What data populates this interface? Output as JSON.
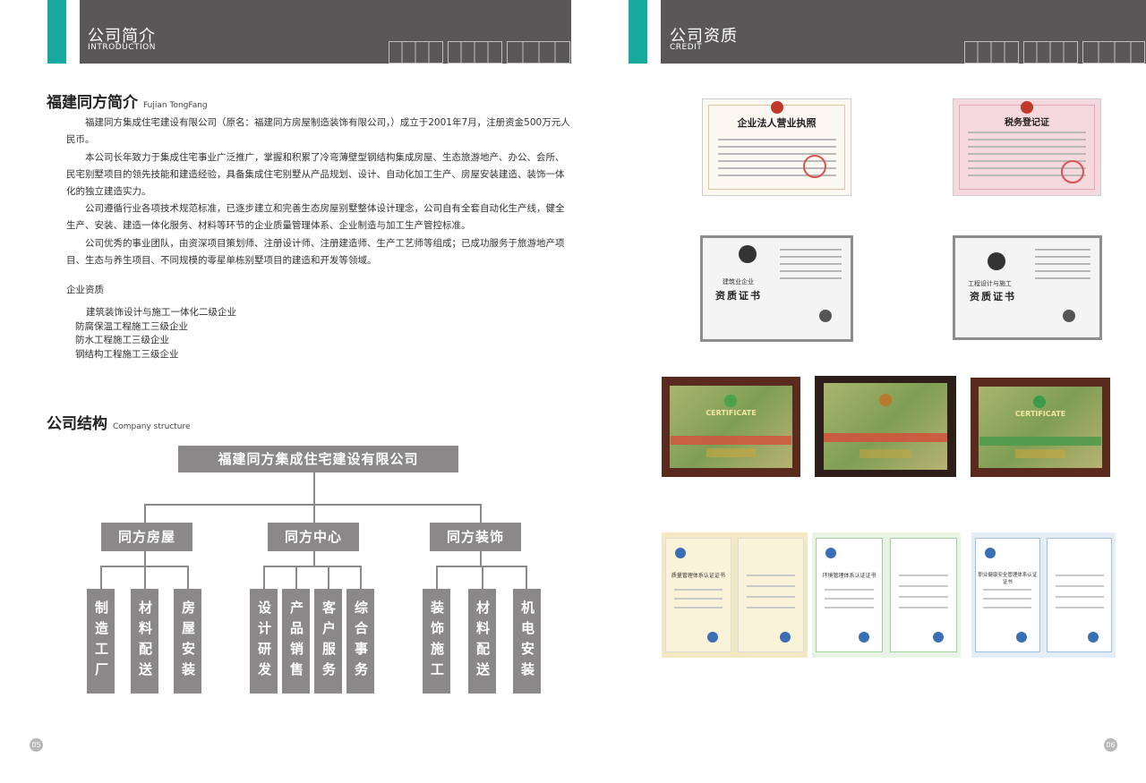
{
  "left_header": {
    "title": "公司简介",
    "subtitle": "INTRODUCTION"
  },
  "right_header": {
    "title": "公司资质",
    "subtitle": "CREDIT"
  },
  "intro": {
    "title": "福建同方简介",
    "title_en": "Fujian TongFang",
    "paragraphs": [
      "福建同方集成住宅建设有限公司（原名：福建同方房屋制造装饰有限公司，）成立于2001年7月，注册资金500万元人民币。",
      "本公司长年致力于集成住宅事业广泛推广，掌握和积累了冷弯薄壁型钢结构集成房屋、生态旅游地产、办公、会所、民宅别墅项目的领先技能和建造经验，具备集成住宅别墅从产品规划、设计、自动化加工生产、房屋安装建造、装饰一体化的独立建造实力。",
      "公司遵循行业各项技术规范标准，已逐步建立和完善生态房屋别墅整体设计理念，公司自有全套自动化生产线，健全生产、安装、建造一体化服务、材料等环节的企业质量管理体系、企业制造与加工生产管控标准。",
      "公司优秀的事业团队，由资深项目策划师、注册设计师、注册建造师、生产工艺师等组成；已成功服务于旅游地产项目、生态与养生项目、不同规模的零星单栋别墅项目的建造和开发等领域。"
    ],
    "qualification_label": "企业资质",
    "qualifications": [
      "建筑装饰设计与施工一体化二级企业",
      "防腐保温工程施工三级企业",
      "防水工程施工三级企业",
      "钢结构工程施工三级企业"
    ]
  },
  "structure": {
    "title": "公司结构",
    "title_en": "Company structure",
    "root": "福建同方集成住宅建设有限公司",
    "divisions": [
      {
        "name": "同方房屋",
        "units": [
          "制造工厂",
          "材料配送",
          "房屋安装"
        ]
      },
      {
        "name": "同方中心",
        "units": [
          "设计研发",
          "产品销售",
          "客户服务",
          "综合事务"
        ]
      },
      {
        "name": "同方装饰",
        "units": [
          "装饰施工",
          "材料配送",
          "机电安装"
        ]
      }
    ]
  },
  "certificates": {
    "business_license": "企业法人营业执照",
    "tax_registration": "税务登记证",
    "qual_cert_1_type": "建筑业企业",
    "qual_cert_1": "资质证书",
    "qual_cert_2_type": "工程设计与施工",
    "qual_cert_2": "资质证书",
    "plaque_label": "CERTIFICATE",
    "iso_quality": "质量管理体系认证证书",
    "iso_env": "环境管理体系认证证书",
    "iso_ohs": "职业健康安全管理体系认证证书"
  },
  "page_left": "05",
  "page_right": "06",
  "colors": {
    "header": "#5a5758",
    "accent": "#17a9a0",
    "box": "#8a8888"
  }
}
